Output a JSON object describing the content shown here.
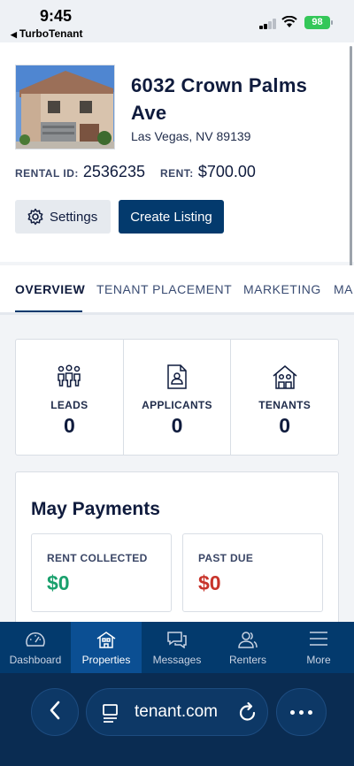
{
  "status_bar": {
    "time": "9:45",
    "back_app": "TurboTenant",
    "battery": "98"
  },
  "property": {
    "address": "6032 Crown Palms Ave",
    "city": "Las Vegas, NV 89139",
    "rental_id_label": "RENTAL ID:",
    "rental_id": "2536235",
    "rent_label": "RENT:",
    "rent": "$700.00",
    "settings_label": "Settings",
    "create_listing_label": "Create Listing"
  },
  "tabs": [
    {
      "label": "OVERVIEW",
      "active": true
    },
    {
      "label": "TENANT PLACEMENT",
      "active": false
    },
    {
      "label": "MARKETING",
      "active": false
    },
    {
      "label": "MA",
      "active": false
    }
  ],
  "stats": [
    {
      "label": "LEADS",
      "value": "0",
      "icon": "people-icon"
    },
    {
      "label": "APPLICANTS",
      "value": "0",
      "icon": "applicant-document-icon"
    },
    {
      "label": "TENANTS",
      "value": "0",
      "icon": "house-people-icon"
    }
  ],
  "payments": {
    "title": "May Payments",
    "rent_collected_label": "RENT COLLECTED",
    "rent_collected": "$0",
    "past_due_label": "PAST DUE",
    "past_due": "$0"
  },
  "nav": [
    {
      "label": "Dashboard",
      "icon": "speedometer-icon"
    },
    {
      "label": "Properties",
      "icon": "house-icon",
      "active": true
    },
    {
      "label": "Messages",
      "icon": "chat-bubbles-icon"
    },
    {
      "label": "Renters",
      "icon": "users-icon"
    },
    {
      "label": "More",
      "icon": "hamburger-icon"
    }
  ],
  "browser": {
    "url": "tenant.com"
  },
  "colors": {
    "navy": "#033a6d",
    "green": "#1aa06d",
    "red": "#c8342b"
  }
}
